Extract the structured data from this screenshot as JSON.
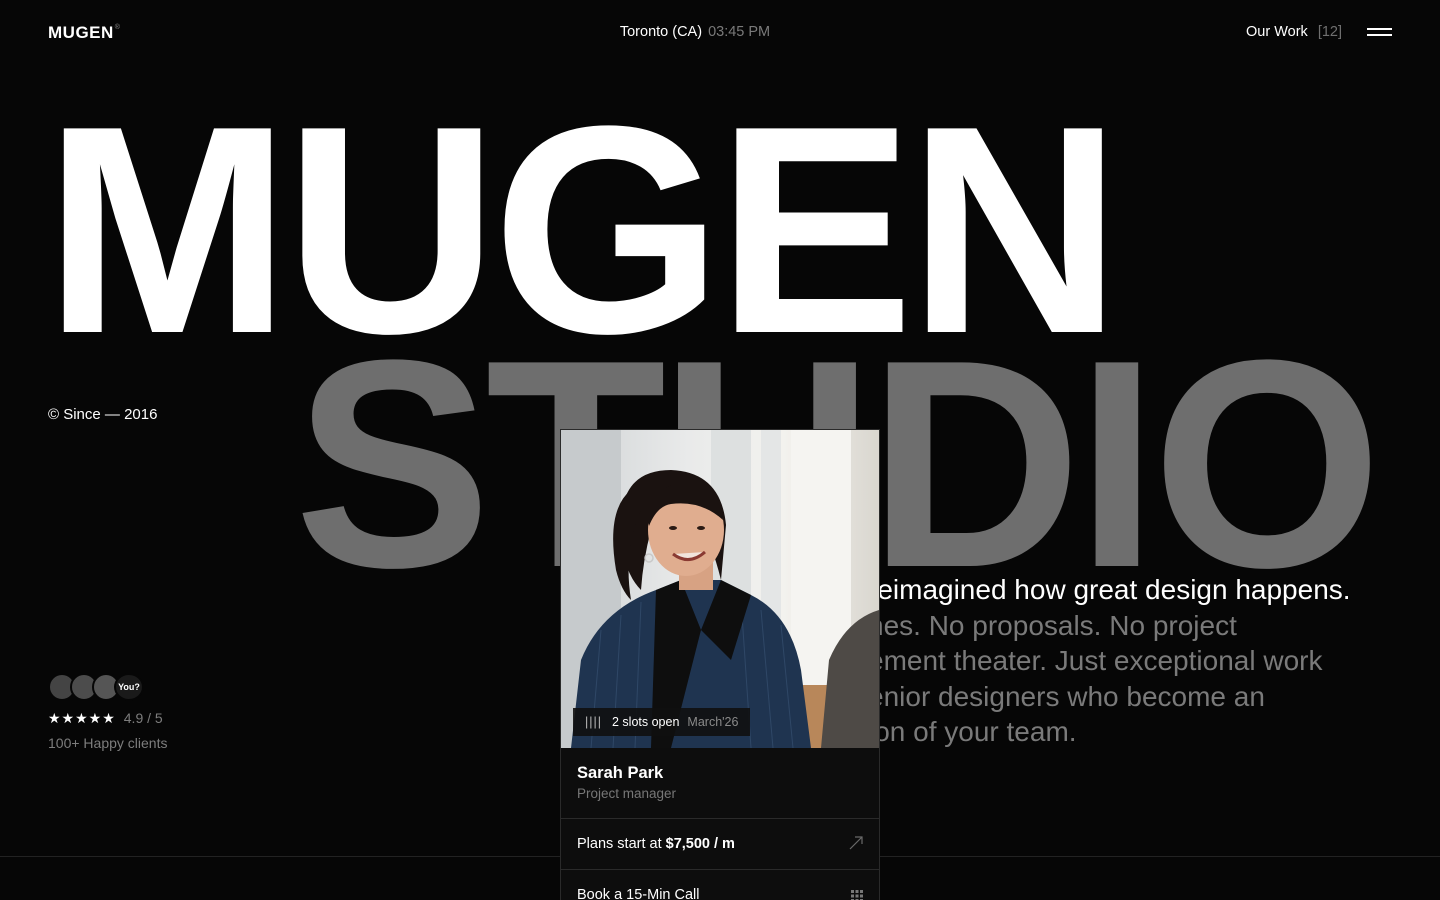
{
  "header": {
    "logo": "MUGEN",
    "logo_mark": "®",
    "city": "Toronto (CA)",
    "time": "03:45 PM",
    "work_link": "Our Work",
    "work_count": "[12]",
    "menu_icon": "hamburger-icon"
  },
  "hero": {
    "title_line1": "MUGEN",
    "title_line2": "STUDIO",
    "since": "© Since — 2016"
  },
  "clients": {
    "you_label": "You?",
    "stars": "★★★★★",
    "score": "4.9 / 5",
    "caption": "100+ Happy clients"
  },
  "description": {
    "line1": "reimagined how great design happens.",
    "line2": "hes. No proposals. No project",
    "line3": "ement theater. Just exceptional work",
    "line4": "enior designers who become an",
    "line5": "ion of your team."
  },
  "card": {
    "slots_bars": "||||",
    "slots_text": "2 slots open",
    "slots_month": "March'26",
    "name": "Sarah Park",
    "role": "Project manager",
    "plans_prefix": "Plans start at",
    "plans_price": "$7,500 / m",
    "book_label": "Book a 15-Min Call"
  },
  "colors": {
    "background": "#060606",
    "title_gray": "#6e6e6e",
    "muted_text": "#7a7a7a"
  }
}
